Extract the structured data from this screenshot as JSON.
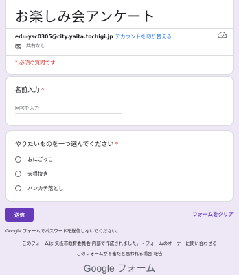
{
  "header": {
    "title": "お楽しみ会アンケート",
    "account_email": "edu-ysc0305@city.yaita.tochigi.jp",
    "switch_account": "アカウントを切り替える",
    "sharing_status": "共有なし",
    "required_note": "* 必須の質問です",
    "cloud_icon": "cloud-saved-icon",
    "share_icon": "not-shared-icon"
  },
  "questions": [
    {
      "title": "名前入力",
      "required_mark": "*",
      "type": "short-answer",
      "placeholder": "回答を入力",
      "value": ""
    },
    {
      "title": "やりたいものを一つ選んでください",
      "required_mark": "*",
      "type": "radio",
      "options": [
        "おにごっこ",
        "大根抜き",
        "ハンカチ落とし"
      ],
      "selected": null
    }
  ],
  "actions": {
    "submit_label": "送信",
    "clear_label": "フォームをクリア"
  },
  "footer": {
    "password_note": "Google フォームでパスワードを送信しないでください。",
    "created_by_text": "このフォームは 矢板市教育委員会 内部で作成されました。 -",
    "contact_owner": "フォームのオーナーに問い合わせる",
    "abuse_text": "このフォームが不審だと思われる場合",
    "report_link": "報告",
    "brand": "Google フォーム"
  },
  "colors": {
    "accent": "#673ab7",
    "background": "#ede7f6",
    "required": "#d93025",
    "link": "#1a73e8"
  }
}
